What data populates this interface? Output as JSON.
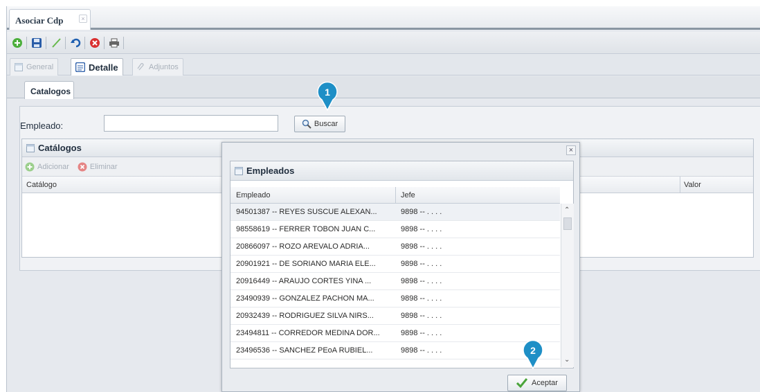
{
  "window": {
    "tab_title": "Asociar Cdp",
    "tab_close": "×"
  },
  "toolbar": {
    "icons": [
      "add-icon",
      "save-icon",
      "edit-icon",
      "undo-icon",
      "delete-icon",
      "print-icon"
    ]
  },
  "subtabs": [
    {
      "label": "General",
      "active": false
    },
    {
      "label": "Detalle",
      "active": true
    },
    {
      "label": "Adjuntos",
      "active": false
    }
  ],
  "catalog_tab": "Catalogos",
  "search": {
    "label": "Empleado:",
    "value": "",
    "button": "Buscar"
  },
  "catalogs_grid": {
    "title": "Catálogos",
    "add_label": "Adicionar",
    "delete_label": "Eliminar",
    "columns": [
      "Catálogo",
      "Valor"
    ]
  },
  "modal": {
    "close": "×",
    "title": "Empleados",
    "columns": [
      "Empleado",
      "Jefe"
    ],
    "rows": [
      {
        "empleado": "94501387 -- REYES SUSCUE ALEXAN...",
        "jefe": "9898 -- . . . ."
      },
      {
        "empleado": "98558619 -- FERRER TOBON JUAN C...",
        "jefe": "9898 -- . . . ."
      },
      {
        "empleado": "20866097 -- ROZO AREVALO ADRIA...",
        "jefe": "9898 -- . . . ."
      },
      {
        "empleado": "20901921 -- DE SORIANO MARIA ELE...",
        "jefe": "9898 -- . . . ."
      },
      {
        "empleado": "20916449 -- ARAUJO CORTES YINA ...",
        "jefe": "9898 -- . . . ."
      },
      {
        "empleado": "23490939 -- GONZALEZ PACHON MA...",
        "jefe": "9898 -- . . . ."
      },
      {
        "empleado": "20932439 -- RODRIGUEZ SILVA NIRS...",
        "jefe": "9898 -- . . . ."
      },
      {
        "empleado": "23494811 -- CORREDOR MEDINA DOR...",
        "jefe": "9898 -- . . . ."
      },
      {
        "empleado": "23496536 -- SANCHEZ PEoA RUBIEL...",
        "jefe": "9898 -- . . . ."
      },
      {
        "empleado": "",
        "jefe": ""
      }
    ],
    "accept_button": "Aceptar"
  },
  "callouts": [
    {
      "label": "1",
      "color": "#1e8fc6"
    },
    {
      "label": "2",
      "color": "#1e8fc6"
    }
  ]
}
